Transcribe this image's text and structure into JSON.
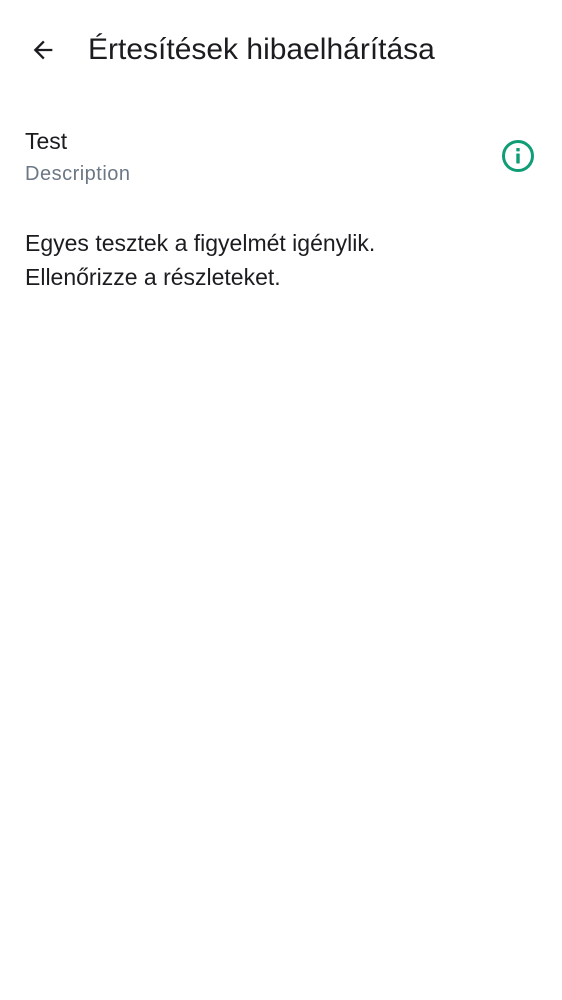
{
  "header": {
    "back_icon": "arrow-left-icon",
    "title": "Értesítések hibaelhárítása"
  },
  "tests": [
    {
      "name": "Test",
      "description": "Description",
      "status_icon": "info-icon",
      "status_color": "#0f9d76"
    }
  ],
  "message": {
    "line1": "Egyes tesztek a figyelmét igénylik.",
    "line2": "Ellenőrizze a részleteket."
  }
}
